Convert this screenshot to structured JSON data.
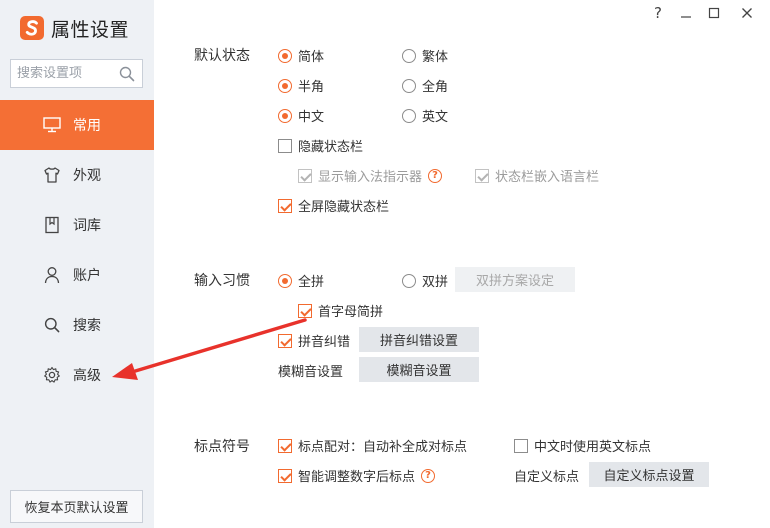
{
  "app": {
    "title": "属性设置"
  },
  "titlebar": {
    "help": "?",
    "minimize": "—",
    "maximize": "☐",
    "close": "✕"
  },
  "search": {
    "placeholder": "搜索设置项"
  },
  "sidebar": {
    "items": [
      {
        "label": "常用",
        "icon": "monitor-icon",
        "active": true
      },
      {
        "label": "外观",
        "icon": "shirt-icon",
        "active": false
      },
      {
        "label": "词库",
        "icon": "book-icon",
        "active": false
      },
      {
        "label": "账户",
        "icon": "user-icon",
        "active": false
      },
      {
        "label": "搜索",
        "icon": "search-icon",
        "active": false
      },
      {
        "label": "高级",
        "icon": "gear-icon",
        "active": false
      }
    ],
    "reset_label": "恢复本页默认设置"
  },
  "default_state": {
    "label": "默认状态",
    "simplified": "简体",
    "traditional": "繁体",
    "halfwidth": "半角",
    "fullwidth": "全角",
    "chinese": "中文",
    "english": "英文",
    "hide_statusbar": "隐藏状态栏",
    "show_indicator": "显示输入法指示器",
    "embed_langbar": "状态栏嵌入语言栏",
    "fullscreen_hide": "全屏隐藏状态栏",
    "selected": {
      "script": "简体",
      "width": "半角",
      "language": "中文"
    },
    "checked": {
      "hide_statusbar": false,
      "show_indicator": true,
      "embed_langbar": true,
      "fullscreen_hide": true
    }
  },
  "input_habit": {
    "label": "输入习惯",
    "full_pinyin": "全拼",
    "double_pinyin": "双拼",
    "double_scheme_btn": "双拼方案设定",
    "initials_abbr": "首字母简拼",
    "pinyin_correct": "拼音纠错",
    "pinyin_correct_btn": "拼音纠错设置",
    "fuzzy_label": "模糊音设置",
    "fuzzy_btn": "模糊音设置",
    "selected": "全拼",
    "checked": {
      "initials_abbr": true,
      "pinyin_correct": true
    }
  },
  "punctuation": {
    "label": "标点符号",
    "pairing": "标点配对：自动补全成对标点",
    "english_in_chinese": "中文时使用英文标点",
    "smart_adjust": "智能调整数字后标点",
    "custom_label": "自定义标点",
    "custom_btn": "自定义标点设置",
    "checked": {
      "pairing": true,
      "english_in_chinese": false,
      "smart_adjust": true
    }
  },
  "colors": {
    "accent": "#f46f35",
    "sidebar_bg": "#eef1f5",
    "arrow": "#e8322b"
  }
}
